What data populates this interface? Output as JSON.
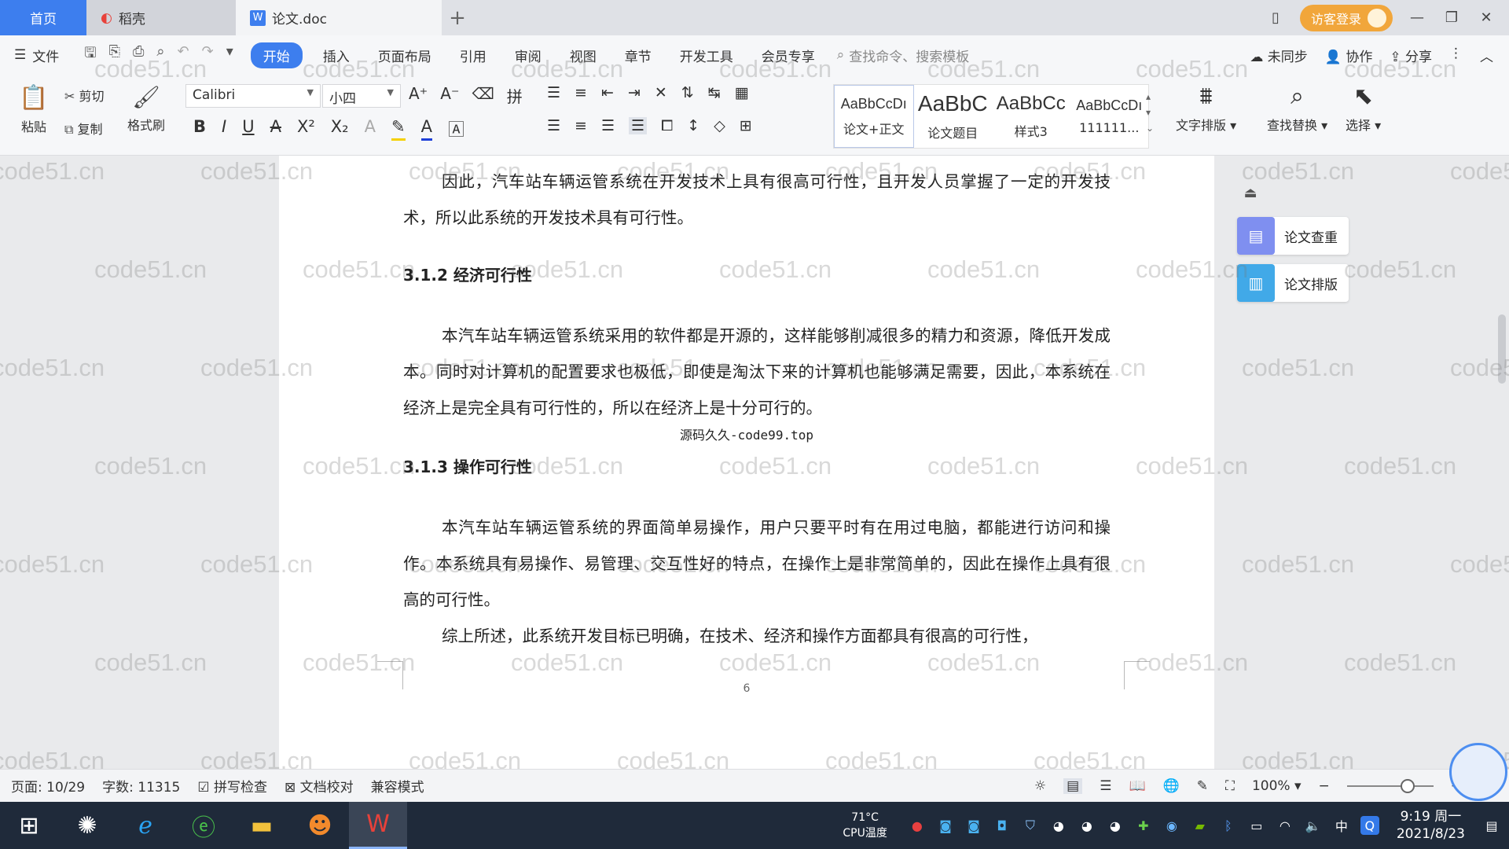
{
  "tabs": [
    {
      "label": "首页"
    },
    {
      "label": "稻壳"
    },
    {
      "label": "论文.doc"
    }
  ],
  "titlebar": {
    "visitor_label": "访客登录"
  },
  "menu": {
    "file": "文件",
    "items": [
      "开始",
      "插入",
      "页面布局",
      "引用",
      "审阅",
      "视图",
      "章节",
      "开发工具",
      "会员专享"
    ],
    "search_placeholder": "查找命令、搜索模板",
    "right": [
      "未同步",
      "协作",
      "分享"
    ]
  },
  "ribbon": {
    "paste": "粘贴",
    "cut": "剪切",
    "copy": "复制",
    "format_painter": "格式刷",
    "font_name": "Calibri",
    "font_size": "小四",
    "styles": [
      {
        "preview": "AaBbCcDı",
        "name": "论文+正文"
      },
      {
        "preview": "AaBbC",
        "name": "论文题目"
      },
      {
        "preview": "AaBbCc",
        "name": "样式3"
      },
      {
        "preview": "AaBbCcDı",
        "name": "111111..."
      }
    ],
    "text_layout": "文字排版",
    "find_replace": "查找替换",
    "select": "选择"
  },
  "document": {
    "p1": "因此，汽车站车辆运管系统在开发技术上具有很高可行性，且开发人员掌握了一定的开发技术，所以此系统的开发技术具有可行性。",
    "h1": "3.1.2 经济可行性",
    "p2": "本汽车站车辆运管系统采用的软件都是开源的，这样能够削减很多的精力和资源，降低开发成本。同时对计算机的配置要求也极低，即使是淘汰下来的计算机也能够满足需要，因此，本系统在经济上是完全具有可行性的，所以在经济上是十分可行的。",
    "watermark_line": "源码久久-code99.top",
    "h2": "3.1.3 操作可行性",
    "p3": "本汽车站车辆运管系统的界面简单易操作，用户只要平时有在用过电脑，都能进行访问和操作。本系统具有易操作、易管理、交互性好的特点，在操作上是非常简单的，因此在操作上具有很高的可行性。",
    "p4": "综上所述，此系统开发目标已明确，在技术、经济和操作方面都具有很高的可行性，",
    "page_number": "6"
  },
  "watermark": "code51.cn",
  "side_panel": {
    "check": "论文查重",
    "layout": "论文排版"
  },
  "status": {
    "page": "页面: 10/29",
    "words": "字数: 11315",
    "spell": "拼写检查",
    "proof": "文档校对",
    "compat": "兼容模式",
    "zoom": "100%",
    "zoom_fraction": 0.7
  },
  "taskbar": {
    "cpu_temp": "71°C",
    "cpu_label": "CPU温度",
    "time": "9:19 周一",
    "date": "2021/8/23",
    "ime": "中"
  },
  "colors": {
    "accent": "#3d7eee",
    "visitor": "#f1a63b",
    "taskbar": "#1f2a3a"
  }
}
